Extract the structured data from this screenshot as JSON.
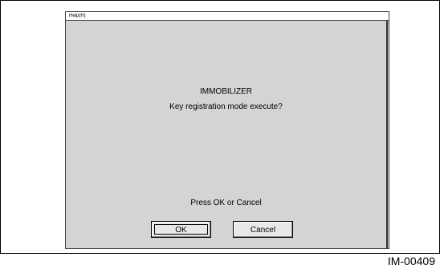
{
  "menu": {
    "help_label": "Help(H)"
  },
  "dialog": {
    "title": "IMMOBILIZER",
    "question": "Key registration mode execute?",
    "instruction": "Press OK or Cancel",
    "ok_label": "OK",
    "cancel_label": "Cancel"
  },
  "figure_id": "IM-00409"
}
